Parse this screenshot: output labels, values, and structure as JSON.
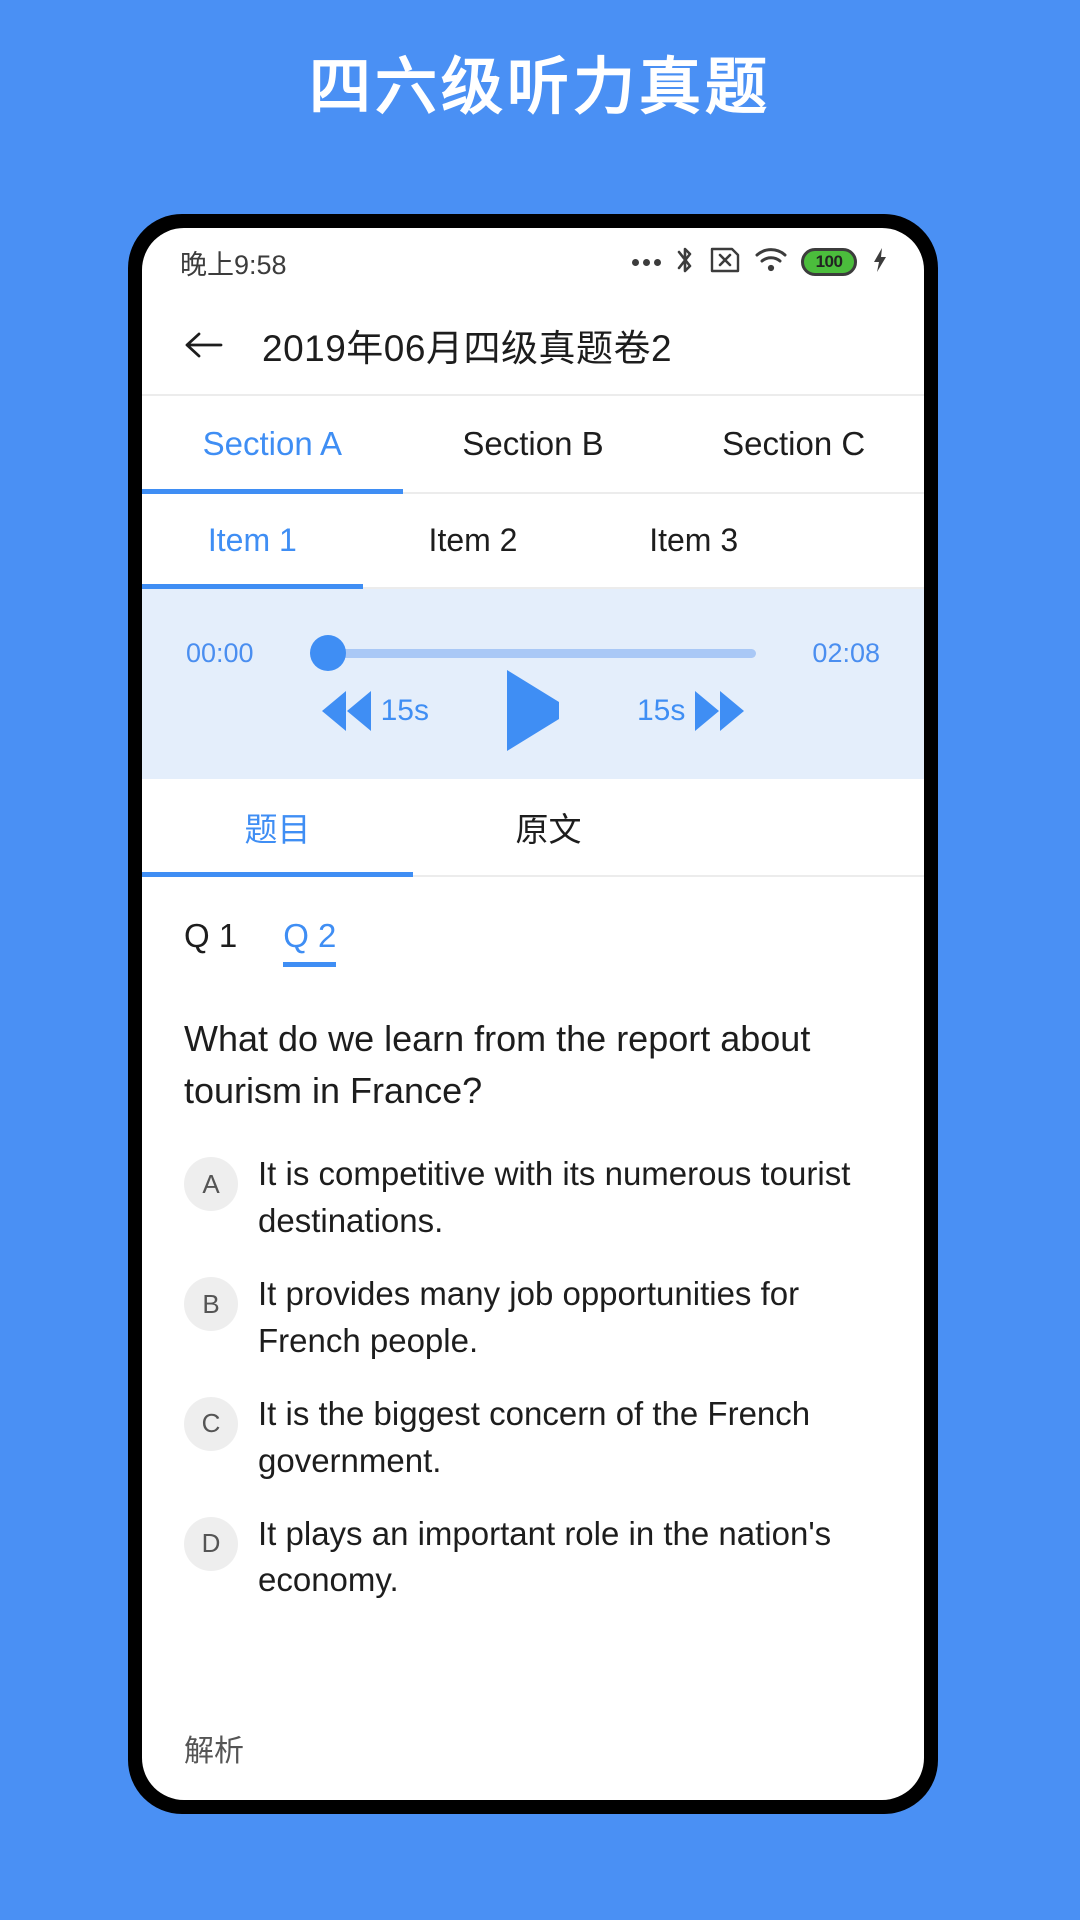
{
  "promo": {
    "title": "四六级听力真题",
    "background_color": "#4a90f4",
    "text_color": "#ffffff"
  },
  "phone": {
    "status_bar": {
      "time": "晚上9:58",
      "icons": [
        {
          "name": "more-dots-icon",
          "glyph": "•••"
        },
        {
          "name": "bluetooth-icon",
          "glyph": "␢"
        },
        {
          "name": "sim-card-off-icon",
          "glyph": "×"
        },
        {
          "name": "wifi-icon",
          "glyph": "wifi"
        },
        {
          "name": "battery-icon",
          "label": "100",
          "color": "#4bbd3c"
        },
        {
          "name": "charging-bolt-icon",
          "glyph": "⚡"
        }
      ],
      "battery_level": "100"
    },
    "app_bar": {
      "back_icon": "back-arrow-icon",
      "title": "2019年06月四级真题卷2"
    },
    "section_tabs": {
      "active_index": 0,
      "items": [
        {
          "label": "Section A"
        },
        {
          "label": "Section B"
        },
        {
          "label": "Section C"
        }
      ]
    },
    "item_tabs": {
      "active_index": 0,
      "items": [
        {
          "label": "Item 1"
        },
        {
          "label": "Item 2"
        },
        {
          "label": "Item 3"
        }
      ]
    },
    "player": {
      "current_time": "00:00",
      "duration": "02:08",
      "progress_percent": 0,
      "rewind_label": "15s",
      "forward_label": "15s",
      "play_state": "paused",
      "accent_color": "#3f8ef4",
      "background_color": "#e4eefb"
    },
    "content_tabs": {
      "active_index": 0,
      "items": [
        {
          "label": "题目"
        },
        {
          "label": "原文"
        }
      ]
    },
    "question_panel": {
      "question_tabs": {
        "active_index": 1,
        "items": [
          {
            "label": "Q 1"
          },
          {
            "label": "Q 2"
          }
        ]
      },
      "question_text": "What do we learn from the report about tourism in France?",
      "options": [
        {
          "letter": "A",
          "text": "It is competitive with its numerous tourist destinations."
        },
        {
          "letter": "B",
          "text": "It provides many job opportunities for French people."
        },
        {
          "letter": "C",
          "text": "It is the biggest concern of the French government."
        },
        {
          "letter": "D",
          "text": "It plays an important role in the nation's economy."
        }
      ],
      "analysis_label": "解析"
    }
  }
}
